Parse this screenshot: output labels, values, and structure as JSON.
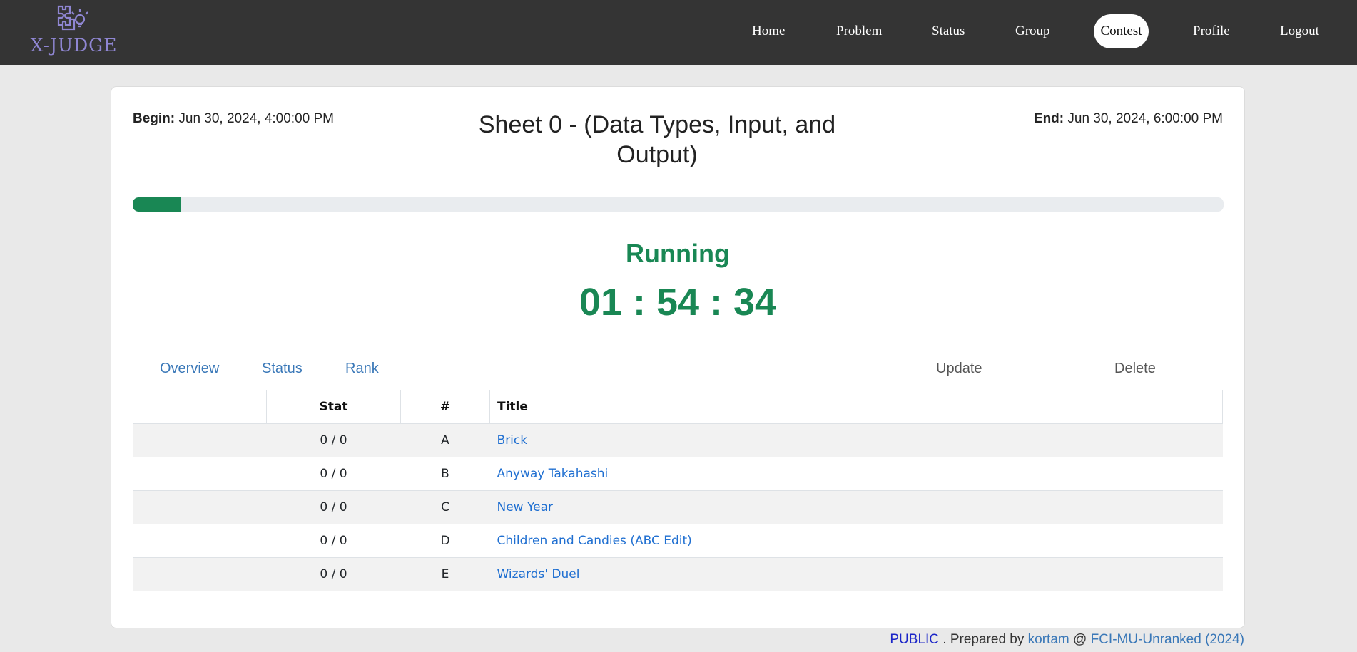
{
  "brand": {
    "logo_text": "X-JUDGE",
    "logo_color": "#8f86d2"
  },
  "nav": {
    "home": "Home",
    "problem": "Problem",
    "status": "Status",
    "group": "Group",
    "contest": "Contest",
    "profile": "Profile",
    "logout": "Logout",
    "active": "Contest"
  },
  "contest": {
    "begin_label": "Begin:",
    "begin_value": "Jun 30, 2024, 4:00:00 PM",
    "end_label": "End:",
    "end_value": "Jun 30, 2024, 6:00:00 PM",
    "title": "Sheet 0 - (Data Types, Input, and Output)",
    "progress_fraction": 0.044,
    "state": "Running",
    "remaining": "01 : 54 : 34",
    "accent_color": "#198754"
  },
  "tabs": {
    "overview": "Overview",
    "status": "Status",
    "rank": "Rank"
  },
  "actions": {
    "update": "Update",
    "delete": "Delete"
  },
  "table": {
    "headers": {
      "blank": "",
      "stat": "Stat",
      "index": "#",
      "title": "Title"
    },
    "rows": [
      {
        "stat": "0 / 0",
        "index": "A",
        "title": "Brick"
      },
      {
        "stat": "0 / 0",
        "index": "B",
        "title": "Anyway Takahashi"
      },
      {
        "stat": "0 / 0",
        "index": "C",
        "title": "New Year"
      },
      {
        "stat": "0 / 0",
        "index": "D",
        "title": "Children and Candies (ABC Edit)"
      },
      {
        "stat": "0 / 0",
        "index": "E",
        "title": "Wizards' Duel"
      }
    ]
  },
  "footer": {
    "visibility": "PUBLIC",
    "prepared_by": ". Prepared by",
    "author": "kortam",
    "at": "@",
    "group": "FCI-MU-Unranked (2024)"
  }
}
